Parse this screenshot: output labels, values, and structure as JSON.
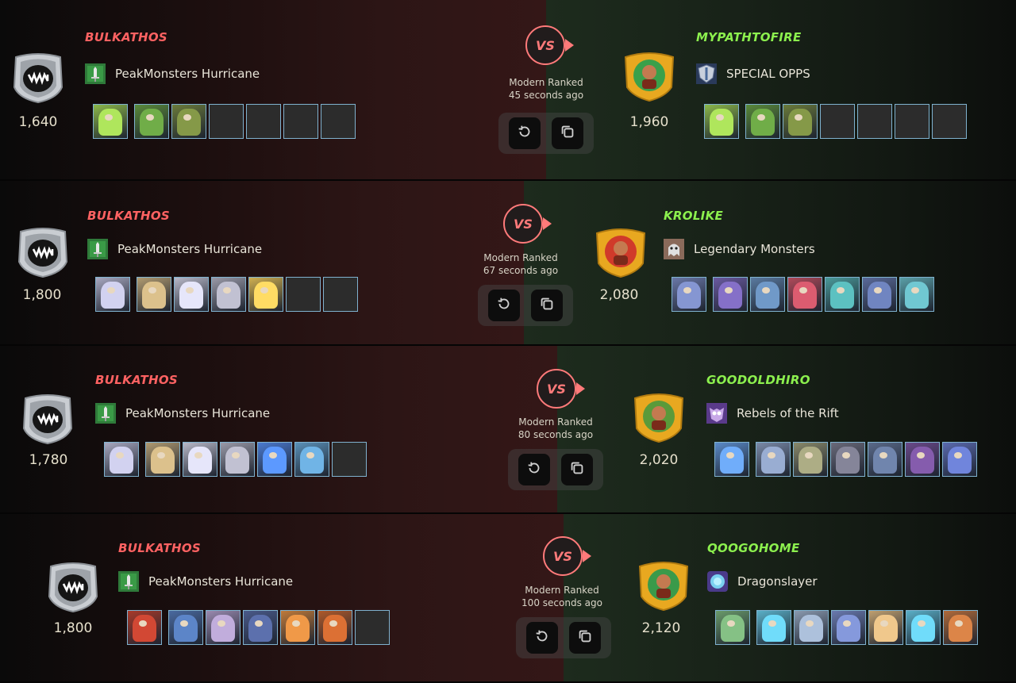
{
  "battles": [
    {
      "player": {
        "name": "BULKATHOS",
        "rating": "1,640",
        "guild": "PeakMonsters Hurricane",
        "guild_icon": "sword-banner-icon",
        "cards": [
          {
            "filled": true,
            "color": "#8cb84a"
          },
          {
            "filled": true,
            "color": "#5a8a3a"
          },
          {
            "filled": true,
            "color": "#6a7a3a"
          },
          {
            "filled": false
          },
          {
            "filled": false
          },
          {
            "filled": false
          },
          {
            "filled": false
          }
        ]
      },
      "opponent": {
        "name": "MYPATHTOFIRE",
        "rating": "1,960",
        "guild": "SPECIAL OPPS",
        "guild_icon": "shield-icon",
        "cards": [
          {
            "filled": true,
            "color": "#8cb84a"
          },
          {
            "filled": true,
            "color": "#5a8a3a"
          },
          {
            "filled": true,
            "color": "#6a7a3a"
          },
          {
            "filled": false
          },
          {
            "filled": false
          },
          {
            "filled": false
          },
          {
            "filled": false
          }
        ]
      },
      "vs_label": "VS",
      "format": "Modern Ranked",
      "time": "45 seconds ago"
    },
    {
      "player": {
        "name": "BULKATHOS",
        "rating": "1,800",
        "guild": "PeakMonsters Hurricane",
        "guild_icon": "sword-banner-icon",
        "cards": [
          {
            "filled": true,
            "color": "#a8a8c0"
          },
          {
            "filled": true,
            "color": "#b09a70"
          },
          {
            "filled": true,
            "color": "#b8b8c8"
          },
          {
            "filled": true,
            "color": "#9a9aa8"
          },
          {
            "filled": true,
            "color": "#d0b050"
          },
          {
            "filled": false
          },
          {
            "filled": false
          }
        ]
      },
      "opponent": {
        "name": "KROLIKE",
        "rating": "2,080",
        "guild": "Legendary Monsters",
        "guild_icon": "ghost-icon",
        "cards": [
          {
            "filled": true,
            "color": "#6a78a8"
          },
          {
            "filled": true,
            "color": "#6a5aa0"
          },
          {
            "filled": true,
            "color": "#5a7aa0"
          },
          {
            "filled": true,
            "color": "#b04a5a"
          },
          {
            "filled": true,
            "color": "#4a9a9a"
          },
          {
            "filled": true,
            "color": "#5a6a9a"
          },
          {
            "filled": true,
            "color": "#5aa0a8"
          }
        ]
      },
      "vs_label": "VS",
      "format": "Modern Ranked",
      "time": "67 seconds ago"
    },
    {
      "player": {
        "name": "BULKATHOS",
        "rating": "1,780",
        "guild": "PeakMonsters Hurricane",
        "guild_icon": "sword-banner-icon",
        "cards": [
          {
            "filled": true,
            "color": "#a8a8c0"
          },
          {
            "filled": true,
            "color": "#b09a70"
          },
          {
            "filled": true,
            "color": "#b8b8c8"
          },
          {
            "filled": true,
            "color": "#9a9aa8"
          },
          {
            "filled": true,
            "color": "#4a7ad0"
          },
          {
            "filled": true,
            "color": "#5a90b8"
          },
          {
            "filled": false
          }
        ]
      },
      "opponent": {
        "name": "GOODOLDHIRO",
        "rating": "2,020",
        "guild": "Rebels of the Rift",
        "guild_icon": "owl-icon",
        "cards": [
          {
            "filled": true,
            "color": "#5a8ac8"
          },
          {
            "filled": true,
            "color": "#7a8aa8"
          },
          {
            "filled": true,
            "color": "#8a8a6a"
          },
          {
            "filled": true,
            "color": "#6a6a7a"
          },
          {
            "filled": true,
            "color": "#5a6a8a"
          },
          {
            "filled": true,
            "color": "#6a4a8a"
          },
          {
            "filled": true,
            "color": "#5a6ab0"
          }
        ]
      },
      "vs_label": "VS",
      "format": "Modern Ranked",
      "time": "80 seconds ago"
    },
    {
      "player": {
        "name": "BULKATHOS",
        "rating": "1,800",
        "guild": "PeakMonsters Hurricane",
        "guild_icon": "sword-banner-icon",
        "cards": [
          {
            "filled": true,
            "color": "#a83a2a"
          },
          {
            "filled": true,
            "color": "#4a6aa0"
          },
          {
            "filled": true,
            "color": "#9a8ab0"
          },
          {
            "filled": true,
            "color": "#4a5a8a"
          },
          {
            "filled": true,
            "color": "#c07a3a"
          },
          {
            "filled": true,
            "color": "#b05a2a"
          },
          {
            "filled": false
          }
        ]
      },
      "opponent": {
        "name": "QOOGOHOME",
        "rating": "2,120",
        "guild": "Dragonslayer",
        "guild_icon": "orb-icon",
        "cards": [
          {
            "filled": true,
            "color": "#6a9a6a"
          },
          {
            "filled": true,
            "color": "#5ab0c8"
          },
          {
            "filled": true,
            "color": "#8a9ab0"
          },
          {
            "filled": true,
            "color": "#6a7ab0"
          },
          {
            "filled": true,
            "color": "#c0a070"
          },
          {
            "filled": true,
            "color": "#5ab0c8"
          },
          {
            "filled": true,
            "color": "#b06a3a"
          }
        ]
      },
      "vs_label": "VS",
      "format": "Modern Ranked",
      "time": "100 seconds ago"
    }
  ],
  "icons": {
    "replay": "replay-icon",
    "copy": "copy-icon",
    "league_badge": "league-badge-icon",
    "avatar": "player-avatar-icon"
  }
}
